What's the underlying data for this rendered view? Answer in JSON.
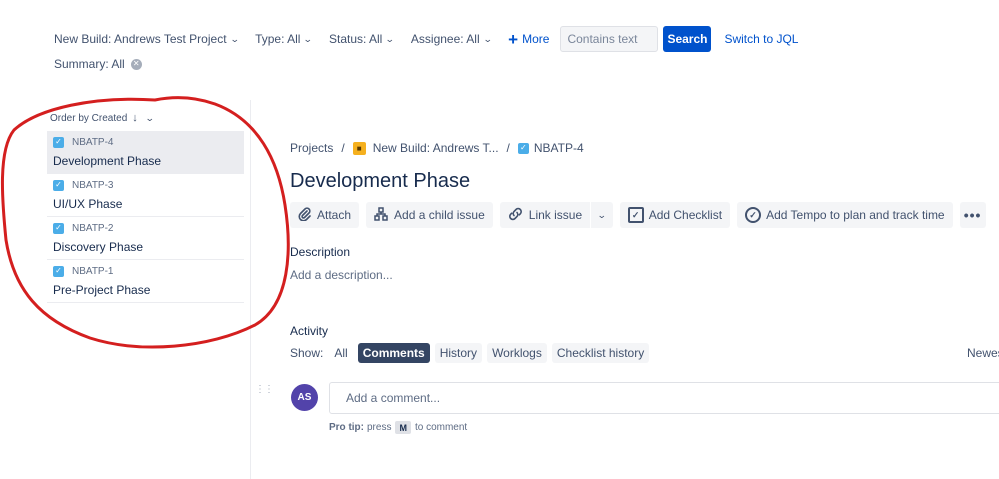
{
  "filters": {
    "project": "New Build: Andrews Test Project",
    "type": "Type: All",
    "status": "Status: All",
    "assignee": "Assignee: All",
    "more": "More",
    "search_placeholder": "Contains text",
    "search_button": "Search",
    "switch_jql": "Switch to JQL",
    "summary": "Summary: All"
  },
  "list": {
    "order_by": "Order by Created",
    "issues": [
      {
        "key": "NBATP-4",
        "summary": "Development Phase",
        "selected": true
      },
      {
        "key": "NBATP-3",
        "summary": "UI/UX Phase",
        "selected": false
      },
      {
        "key": "NBATP-2",
        "summary": "Discovery Phase",
        "selected": false
      },
      {
        "key": "NBATP-1",
        "summary": "Pre-Project Phase",
        "selected": false
      }
    ]
  },
  "breadcrumb": {
    "projects": "Projects",
    "project": "New Build: Andrews T...",
    "issue_key": "NBATP-4"
  },
  "issue": {
    "title": "Development Phase",
    "description_label": "Description",
    "description_placeholder": "Add a description..."
  },
  "toolbar": {
    "attach": "Attach",
    "add_child": "Add a child issue",
    "link_issue": "Link issue",
    "add_checklist": "Add Checklist",
    "add_tempo": "Add Tempo to plan and track time",
    "more_dots": "•••"
  },
  "activity": {
    "label": "Activity",
    "show_label": "Show:",
    "tabs": [
      "All",
      "Comments",
      "History",
      "Worklogs",
      "Checklist history"
    ],
    "active_tab": "Comments",
    "sort": "Newes"
  },
  "comment": {
    "avatar_initials": "AS",
    "placeholder": "Add a comment...",
    "pro_tip_label": "Pro tip:",
    "pro_tip_press": "press",
    "pro_tip_key": "M",
    "pro_tip_suffix": "to comment"
  },
  "colors": {
    "primary": "#0052cc",
    "annotation_red": "#d41f1f",
    "avatar": "#5243aa",
    "checkbox_blue": "#4bade8"
  },
  "icons": {
    "chevron": "chevron-down-icon",
    "checkbox": "issue-type-task-icon",
    "attach": "paperclip-icon",
    "child": "hierarchy-icon",
    "link": "link-icon",
    "checklist": "checklist-icon",
    "tempo": "check-circle-icon"
  }
}
